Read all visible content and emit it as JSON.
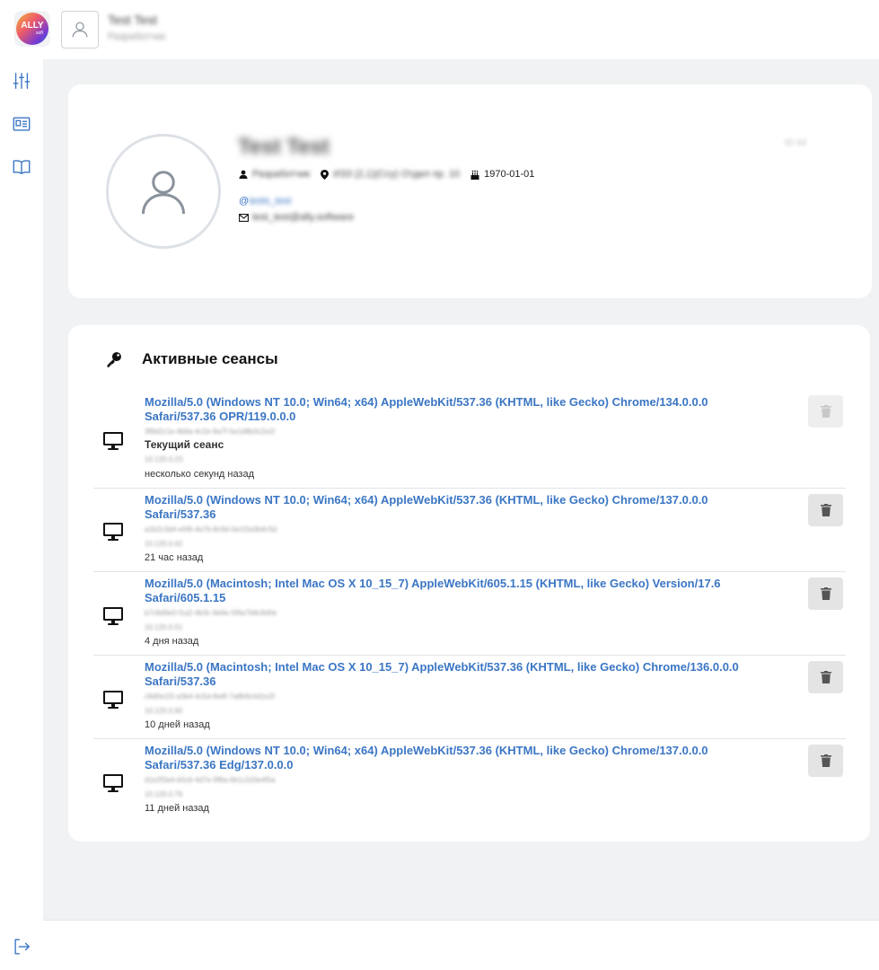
{
  "header": {
    "logo_text": "ALLY",
    "logo_sub": "soft",
    "user_name": "Test Test",
    "user_role": "Разработчик"
  },
  "profile": {
    "name": "Test Test",
    "corner_text": "ID 44",
    "role": "Разработчик",
    "location": "ИЗ3 (2,1)(Ссу) Отдел пр. 10",
    "birthdate": "1970-01-01",
    "handle_prefix": "@",
    "handle": "tests_test",
    "email": "test_test@ally.software"
  },
  "sessions": {
    "title": "Активные сеансы",
    "items": [
      {
        "agent": "Mozilla/5.0 (Windows NT 10.0; Win64; x64) AppleWebKit/537.36 (KHTML, like Gecko) Chrome/134.0.0.0 Safari/537.36 OPR/119.0.0.0",
        "session_id": "3f9d2c1e-4b6a-4c2e-9a7f-5e1d8b3c2a1f",
        "current_label": "Текущий сеанс",
        "ip": "10.120.0.23",
        "time": "несколько секунд назад"
      },
      {
        "agent": "Mozilla/5.0 (Windows NT 10.0; Win64; x64) AppleWebKit/537.36 (KHTML, like Gecko) Chrome/137.0.0.0 Safari/537.36",
        "session_id": "a1b2c3d4-e5f6-4a7b-8c9d-0e1f2a3b4c5d",
        "ip": "10.120.0.42",
        "time": "21 час назад"
      },
      {
        "agent": "Mozilla/5.0 (Macintosh; Intel Mac OS X 10_15_7) AppleWebKit/605.1.15 (KHTML, like Gecko) Version/17.6 Safari/605.1.15",
        "session_id": "b7c8d9e0-f1a2-4b3c-9d4e-5f6a7b8c9d0e",
        "ip": "10.120.0.51",
        "time": "4 дня назад"
      },
      {
        "agent": "Mozilla/5.0 (Macintosh; Intel Mac OS X 10_15_7) AppleWebKit/537.36 (KHTML, like Gecko) Chrome/136.0.0.0 Safari/537.36",
        "session_id": "c9d0e1f2-a3b4-4c5d-8e6f-7a8b9c0d1e2f",
        "ip": "10.120.0.60",
        "time": "10 дней назад"
      },
      {
        "agent": "Mozilla/5.0 (Windows NT 10.0; Win64; x64) AppleWebKit/537.36 (KHTML, like Gecko) Chrome/137.0.0.0 Safari/537.36 Edg/137.0.0.0",
        "session_id": "d1e2f3a4-b5c6-4d7e-9f8a-0b1c2d3e4f5a",
        "ip": "10.120.0.76",
        "time": "11 дней назад"
      }
    ]
  },
  "colors": {
    "accent": "#3b76c4",
    "background": "#f1f2f4",
    "card": "#ffffff"
  },
  "icons": {
    "sidebar": [
      "sliders-icon",
      "id-card-icon",
      "book-icon"
    ],
    "logout": "logout-icon"
  }
}
